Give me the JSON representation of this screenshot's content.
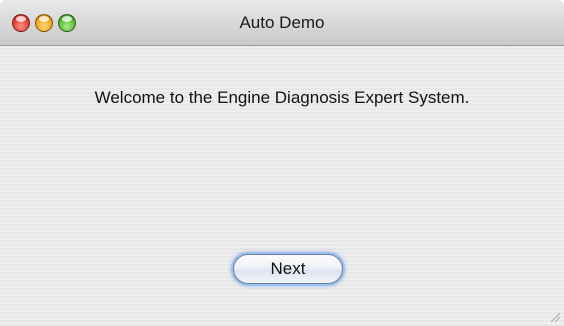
{
  "window": {
    "title": "Auto Demo"
  },
  "content": {
    "welcome_text": "Welcome to the Engine Diagnosis Expert System.",
    "next_label": "Next"
  },
  "colors": {
    "close": "#e0443a",
    "minimize": "#f0a720",
    "zoom": "#5fbb35",
    "focus_ring": "#9cc0ec"
  },
  "icons": {
    "close": "close-icon",
    "minimize": "minimize-icon",
    "zoom": "zoom-icon",
    "resize": "resize-grip-icon"
  }
}
